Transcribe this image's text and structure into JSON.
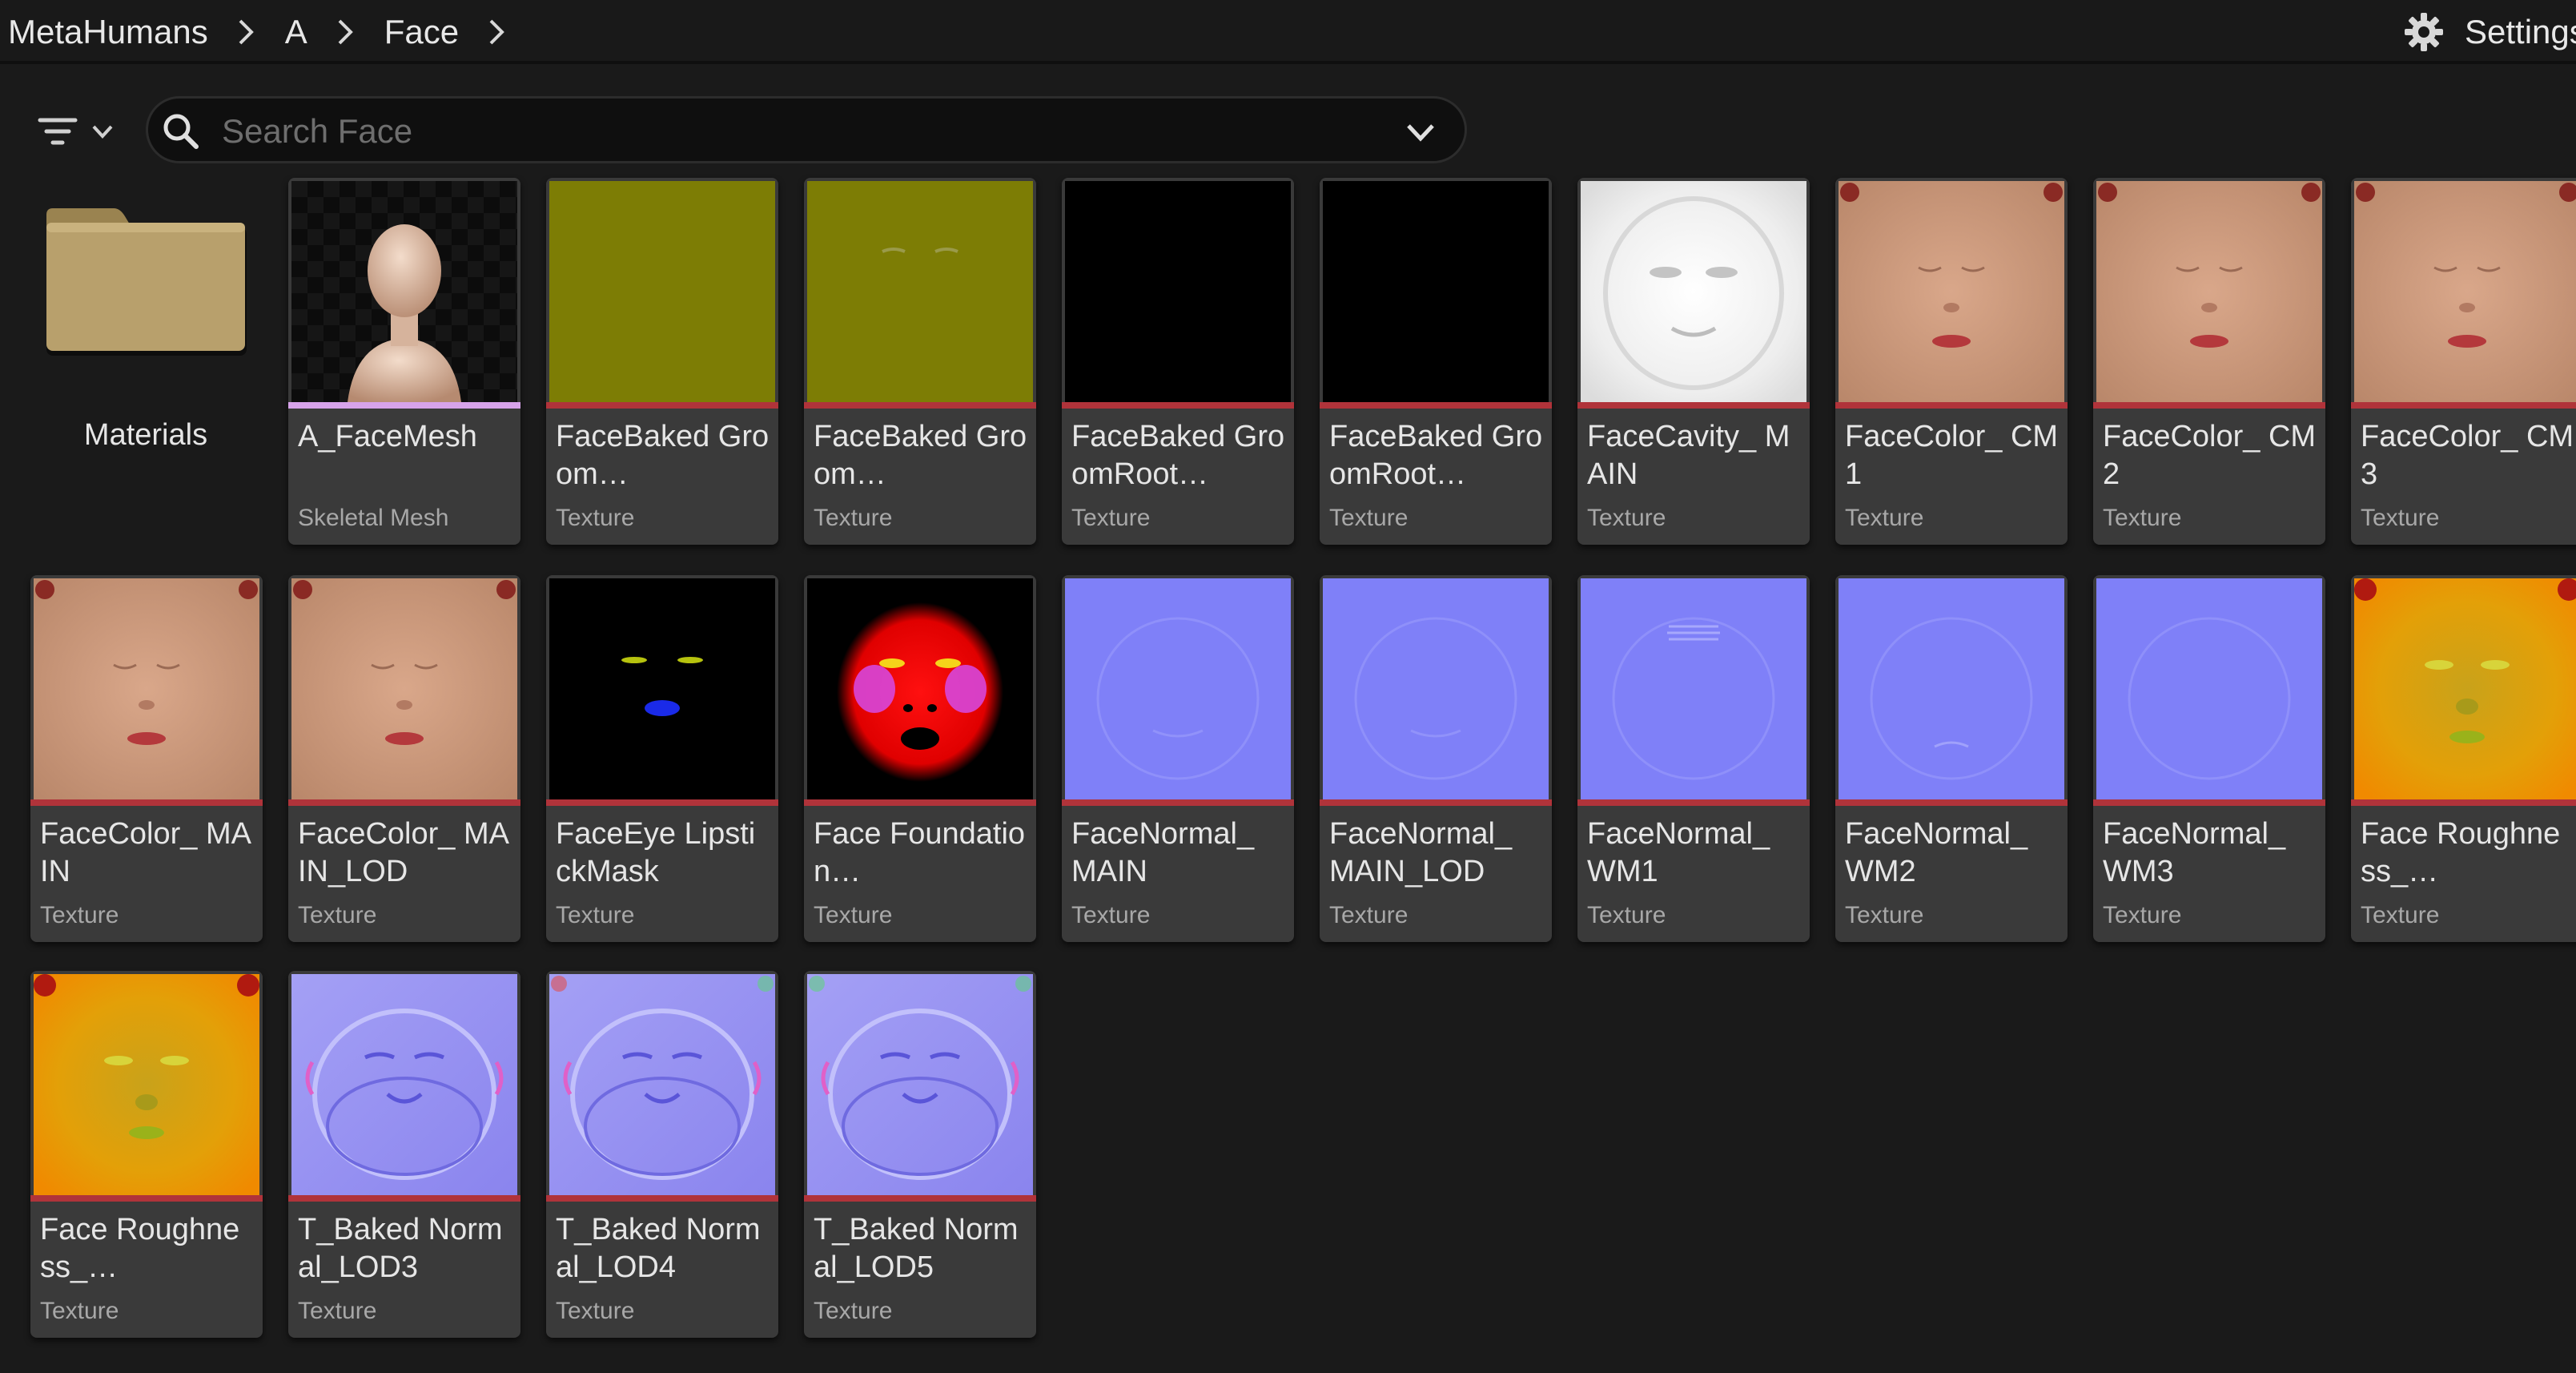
{
  "breadcrumb": [
    "MetaHumans",
    "A",
    "Face"
  ],
  "settings": {
    "label": "Settings"
  },
  "search": {
    "placeholder": "Search Face",
    "value": ""
  },
  "folder": {
    "label": "Materials",
    "icon": "folder-icon"
  },
  "assets": [
    {
      "name": "A_FaceMesh",
      "type": "Skeletal Mesh",
      "thumb": "mesh"
    },
    {
      "name": "FaceBaked Groom…",
      "type": "Texture",
      "thumb": "olive"
    },
    {
      "name": "FaceBaked Groom…",
      "type": "Texture",
      "thumb": "olive-brows"
    },
    {
      "name": "FaceBaked GroomRoot…",
      "type": "Texture",
      "thumb": "black"
    },
    {
      "name": "FaceBaked GroomRoot…",
      "type": "Texture",
      "thumb": "black"
    },
    {
      "name": "FaceCavity_ MAIN",
      "type": "Texture",
      "thumb": "cavity"
    },
    {
      "name": "FaceColor_ CM1",
      "type": "Texture",
      "thumb": "skin"
    },
    {
      "name": "FaceColor_ CM2",
      "type": "Texture",
      "thumb": "skin"
    },
    {
      "name": "FaceColor_ CM3",
      "type": "Texture",
      "thumb": "skin"
    },
    {
      "name": "FaceColor_ MAIN",
      "type": "Texture",
      "thumb": "skin"
    },
    {
      "name": "FaceColor_ MAIN_LOD",
      "type": "Texture",
      "thumb": "skin"
    },
    {
      "name": "FaceEye LipstickMask",
      "type": "Texture",
      "thumb": "eyemask"
    },
    {
      "name": "Face Foundation…",
      "type": "Texture",
      "thumb": "redmask"
    },
    {
      "name": "FaceNormal_ MAIN",
      "type": "Texture",
      "thumb": "normal-flat"
    },
    {
      "name": "FaceNormal_ MAIN_LOD",
      "type": "Texture",
      "thumb": "normal-flat"
    },
    {
      "name": "FaceNormal_ WM1",
      "type": "Texture",
      "thumb": "normal-flat"
    },
    {
      "name": "FaceNormal_ WM2",
      "type": "Texture",
      "thumb": "normal-flat"
    },
    {
      "name": "FaceNormal_ WM3",
      "type": "Texture",
      "thumb": "normal-flat"
    },
    {
      "name": "Face Roughness_…",
      "type": "Texture",
      "thumb": "rough"
    },
    {
      "name": "Face Roughness_…",
      "type": "Texture",
      "thumb": "rough"
    },
    {
      "name": "T_Baked Normal_LOD3",
      "type": "Texture",
      "thumb": "normal-baked"
    },
    {
      "name": "T_Baked Normal_LOD4",
      "type": "Texture",
      "thumb": "normal-baked"
    },
    {
      "name": "T_Baked Normal_LOD5",
      "type": "Texture",
      "thumb": "normal-baked"
    }
  ],
  "colors": {
    "background": "#1a1a1a",
    "tile": "#3a3a3a",
    "texture_stripe": "#b0333a",
    "mesh_stripe": "#d7a3ea"
  }
}
